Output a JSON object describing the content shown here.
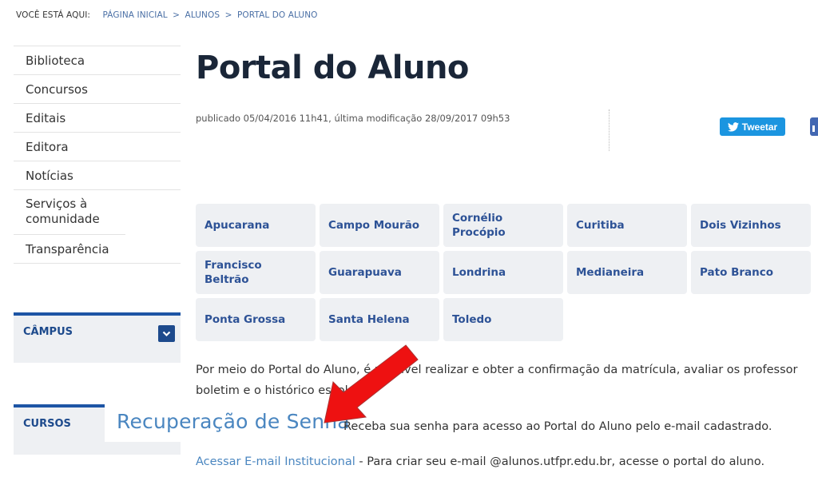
{
  "breadcrumb": {
    "label": "VOCÊ ESTÁ AQUI:",
    "items": [
      "PÁGINA INICIAL",
      "ALUNOS",
      "PORTAL DO ALUNO"
    ],
    "separator": ">"
  },
  "sidebar": {
    "items": [
      {
        "label": "Biblioteca"
      },
      {
        "label": "Concursos"
      },
      {
        "label": "Editais"
      },
      {
        "label": "Editora"
      },
      {
        "label": "Notícias"
      },
      {
        "label": "Serviços à comunidade"
      },
      {
        "label": "Transparência"
      }
    ],
    "boxes": {
      "campus": {
        "title": "CÂMPUS",
        "icon": "chevron-down-icon"
      },
      "cursos": {
        "title": "CURSOS"
      }
    }
  },
  "main": {
    "title": "Portal do Aluno",
    "meta": "publicado 05/04/2016 11h41, última modificação 28/09/2017 09h53",
    "share": {
      "tweet_label": "Tweetar",
      "tweet_icon": "twitter-bird-icon",
      "facebook_icon": "facebook-icon",
      "twitter_color": "#1b95e0",
      "facebook_color": "#4267b2"
    },
    "campuses": [
      "Apucarana",
      "Campo Mourão",
      "Cornélio Procópio",
      "Curitiba",
      "Dois Vizinhos",
      "Francisco Beltrão",
      "Guarapuava",
      "Londrina",
      "Medianeira",
      "Pato Branco",
      "Ponta Grossa",
      "Santa Helena",
      "Toledo"
    ],
    "paragraph1_line1": "Por meio do Portal do Aluno, é possível realizar  e obter a confirmação da matrícula, avaliar os professor",
    "paragraph1_line2": "boletim e o histórico escolar.",
    "recovery": {
      "link": "Recuperação de Senha",
      "text": "Receba sua senha para acesso ao Portal do Aluno pelo e-mail cadastrado."
    },
    "email": {
      "link": "Acessar E-mail Institucional",
      "text": " - Para criar seu e-mail @alunos.utfpr.edu.br, acesse o portal do aluno."
    }
  },
  "annotation": {
    "type": "arrow",
    "color": "#ee1111",
    "points_to": "Recuperação de Senha"
  },
  "colors": {
    "accent": "#1d55a5",
    "link": "#4a86c0",
    "campus_text": "#2d5296",
    "tile_bg": "#eef0f3"
  }
}
